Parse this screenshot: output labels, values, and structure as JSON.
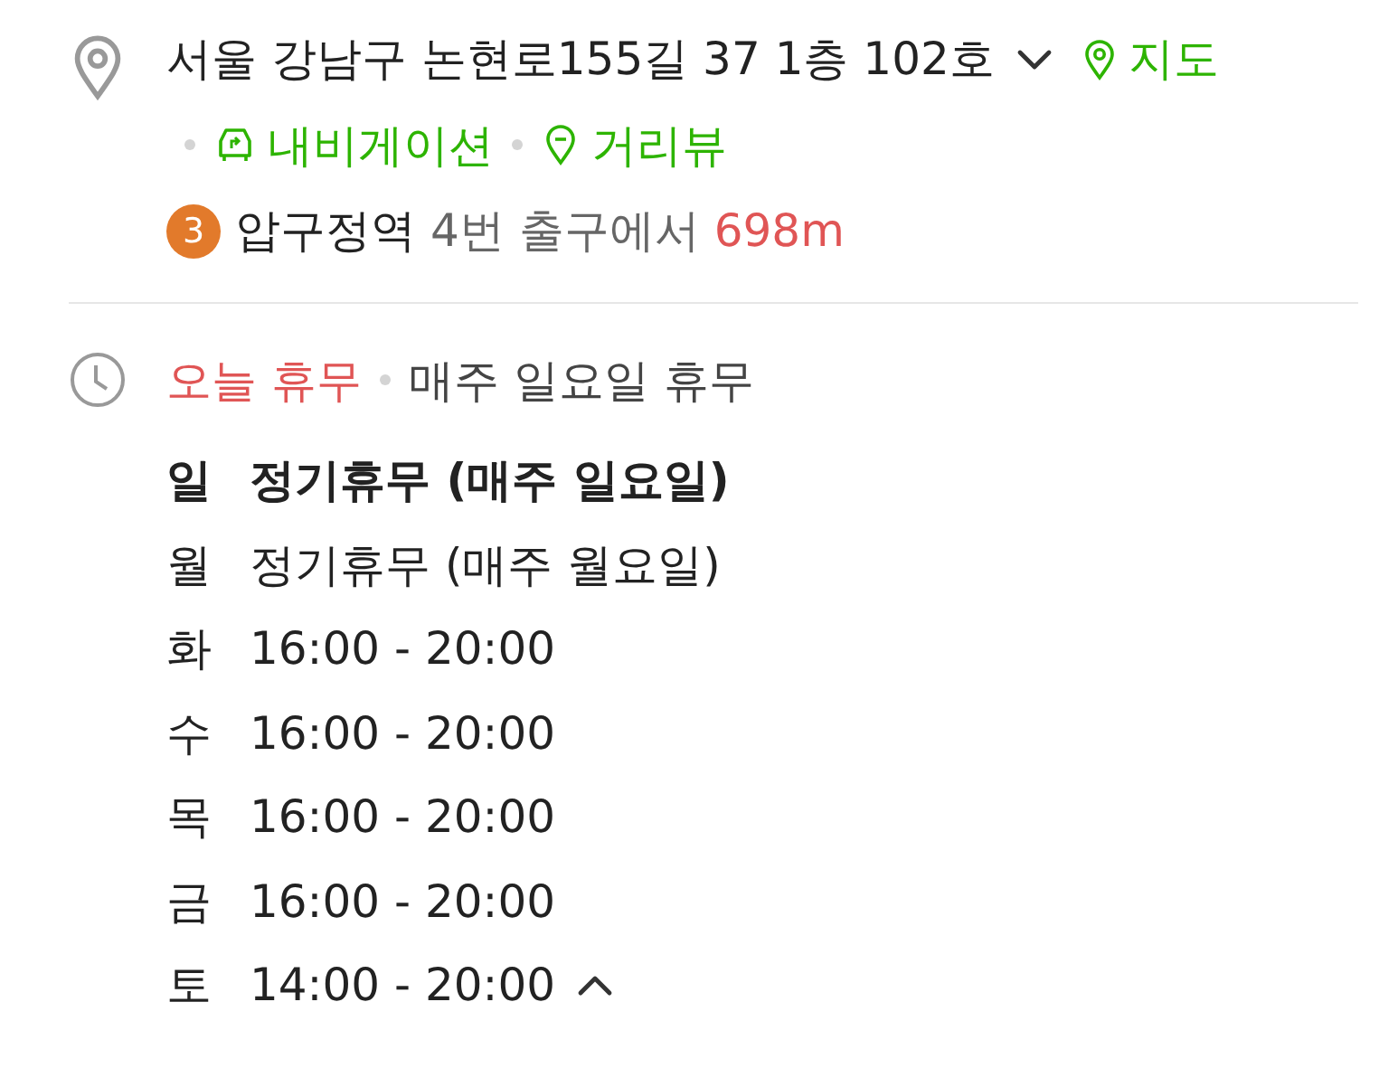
{
  "address": {
    "text": "서울 강남구 논현로155길 37 1층 102호",
    "expanded": false,
    "map_link": "지도",
    "navigation_link": "내비게이션",
    "street_view_link": "거리뷰"
  },
  "subway": {
    "line": "3",
    "color": "#e27a2b",
    "station": "압구정역",
    "exit": "4번 출구에서",
    "distance": "698m"
  },
  "hours": {
    "status": "오늘 휴무",
    "note": "매주 일요일 휴무",
    "expanded": true,
    "days": [
      {
        "day": "일",
        "time": "정기휴무 (매주 일요일)",
        "today": true
      },
      {
        "day": "월",
        "time": "정기휴무 (매주 월요일)",
        "today": false
      },
      {
        "day": "화",
        "time": "16:00 - 20:00",
        "today": false
      },
      {
        "day": "수",
        "time": "16:00 - 20:00",
        "today": false
      },
      {
        "day": "목",
        "time": "16:00 - 20:00",
        "today": false
      },
      {
        "day": "금",
        "time": "16:00 - 20:00",
        "today": false
      },
      {
        "day": "토",
        "time": "14:00 - 20:00",
        "today": false
      }
    ]
  }
}
